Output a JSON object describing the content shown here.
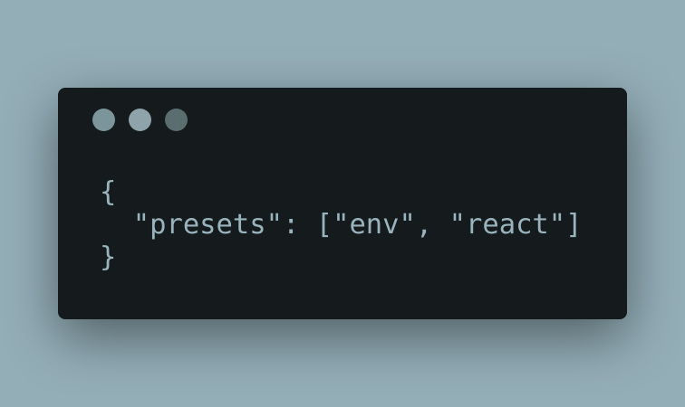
{
  "window": {
    "controls": [
      {
        "name": "close",
        "color": "#7c959b"
      },
      {
        "name": "minimize",
        "color": "#8ea4aa"
      },
      {
        "name": "maximize",
        "color": "#5a6e70"
      }
    ]
  },
  "code": {
    "lines": [
      "{",
      "  \"presets\": [\"env\", \"react\"]",
      "}"
    ],
    "text_color": "#9ab4bd",
    "background": "#151a1c"
  }
}
